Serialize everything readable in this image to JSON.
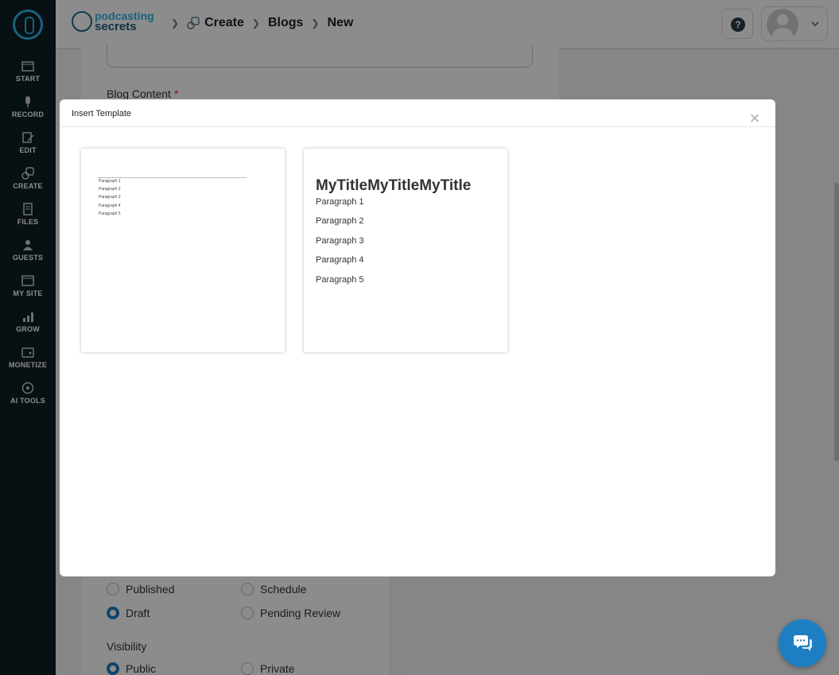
{
  "sidebar": {
    "items": [
      {
        "label": "START",
        "icon": "start-icon"
      },
      {
        "label": "RECORD",
        "icon": "microphone-icon"
      },
      {
        "label": "EDIT",
        "icon": "edit-icon"
      },
      {
        "label": "CREATE",
        "icon": "create-icon"
      },
      {
        "label": "FILES",
        "icon": "files-icon"
      },
      {
        "label": "GUESTS",
        "icon": "guests-icon"
      },
      {
        "label": "MY SITE",
        "icon": "site-icon"
      },
      {
        "label": "GROW",
        "icon": "grow-icon"
      },
      {
        "label": "MONETIZE",
        "icon": "monetize-icon"
      },
      {
        "label": "AI TOOLS",
        "icon": "ai-icon"
      }
    ]
  },
  "header": {
    "brand_line1": "podcasting",
    "brand_line2": "secrets",
    "breadcrumbs": [
      "Create",
      "Blogs",
      "New"
    ]
  },
  "form": {
    "blog_content_label": "Blog Content",
    "required_mark": "*",
    "status_options": [
      {
        "label": "Published",
        "selected": false
      },
      {
        "label": "Schedule",
        "selected": false
      },
      {
        "label": "Draft",
        "selected": true
      },
      {
        "label": "Pending Review",
        "selected": false
      }
    ],
    "visibility_label": "Visibility",
    "visibility_options": [
      {
        "label": "Public",
        "selected": true
      },
      {
        "label": "Private",
        "selected": false
      }
    ]
  },
  "modal": {
    "title": "Insert Template",
    "close_glyph": "×",
    "templates": [
      {
        "paragraphs": [
          "Paragraph 1",
          "Paragraph 2",
          "Paragraph 3",
          "Paragraph 4",
          "Paragraph 5"
        ]
      },
      {
        "title": "MyTitleMyTitleMyTitle",
        "paragraphs": [
          "Paragraph 1",
          "Paragraph 2",
          "Paragraph 3",
          "Paragraph 4",
          "Paragraph 5"
        ]
      }
    ]
  },
  "colors": {
    "sidebar_bg": "#0d1e24",
    "accent": "#1d7fc2",
    "brand_light": "#2fb3e6"
  }
}
